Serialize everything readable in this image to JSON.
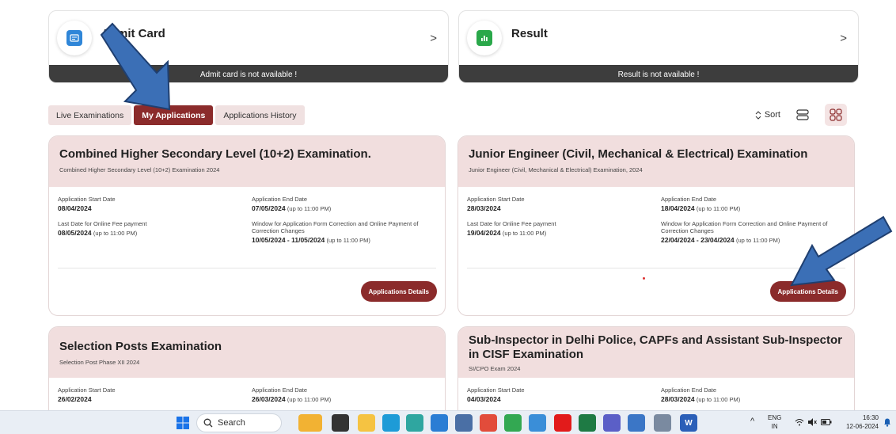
{
  "admit_card": {
    "title": "Admit Card",
    "banner": "Admit card is not available !",
    "chevron": ">"
  },
  "result": {
    "title": "Result",
    "banner": "Result is not available !",
    "chevron": ">"
  },
  "tabs": [
    {
      "label": "Live Examinations"
    },
    {
      "label": "My Applications"
    },
    {
      "label": "Applications History"
    }
  ],
  "toolbar": {
    "sort_label": "Sort"
  },
  "labels": {
    "start": "Application Start Date",
    "end": "Application End Date",
    "fee": "Last Date for Online Fee payment",
    "correction": "Window for Application Form Correction and Online Payment of Correction Changes",
    "details_button": "Applications Details"
  },
  "exams": [
    {
      "title": "Combined Higher Secondary Level (10+2) Examination.",
      "subtitle": "Combined Higher Secondary Level (10+2) Examination 2024",
      "start_date": "08/04/2024",
      "end_date": "07/05/2024",
      "end_note": "(up to 11:00 PM)",
      "fee_date": "08/05/2024",
      "fee_note": "(up to 11:00 PM)",
      "correction_window": "10/05/2024 - 11/05/2024",
      "correction_note": "(up to 11:00 PM)"
    },
    {
      "title": "Junior Engineer (Civil, Mechanical & Electrical) Examination",
      "subtitle": "Junior Engineer (Civil, Mechanical & Electrical) Examination, 2024",
      "start_date": "28/03/2024",
      "end_date": "18/04/2024",
      "end_note": "(up to 11:00 PM)",
      "fee_date": "19/04/2024",
      "fee_note": "(up to 11:00 PM)",
      "correction_window": "22/04/2024 - 23/04/2024",
      "correction_note": "(up to 11:00 PM)"
    },
    {
      "title": "Selection Posts Examination",
      "subtitle": "Selection Post Phase XII 2024",
      "start_date": "26/02/2024",
      "end_date": "26/03/2024",
      "end_note": "(up to 11:00 PM)"
    },
    {
      "title": "Sub-Inspector in Delhi Police, CAPFs and Assistant Sub-Inspector in CISF Examination",
      "subtitle": "SI/CPO Exam 2024",
      "start_date": "04/03/2024",
      "end_date": "28/03/2024",
      "end_note": "(up to 11:00 PM)"
    }
  ],
  "taskbar": {
    "search_placeholder": "Search",
    "lang": "ENG",
    "region": "IN",
    "time": "16:30",
    "date": "12-06-2024"
  },
  "colors": {
    "accent": "#8b2b2b",
    "card_header": "#f1dede",
    "banner": "#3d3d3d",
    "arrow": "#3b6fb6"
  }
}
